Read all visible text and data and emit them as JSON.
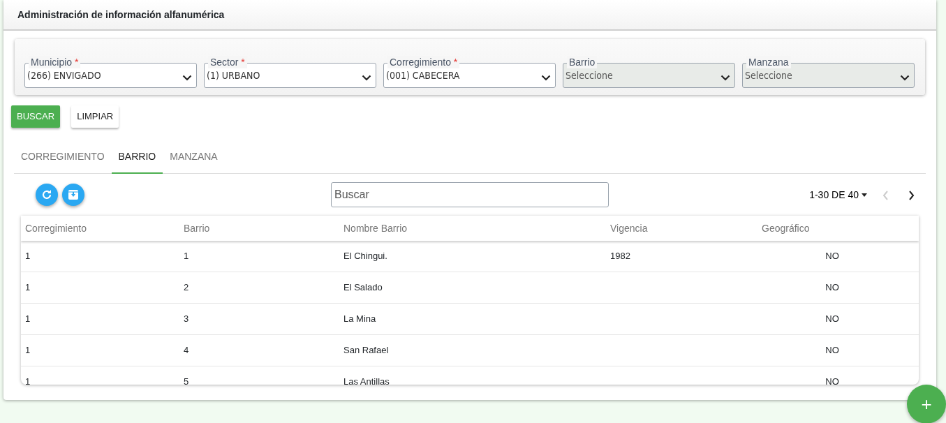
{
  "header": {
    "title": "Administración de información alfanumérica"
  },
  "filters": [
    {
      "label": "Municipio",
      "required_mark": "*",
      "value": "(266) ENVIGADO",
      "disabled": false
    },
    {
      "label": "Sector",
      "required_mark": "*",
      "value": "(1) URBANO",
      "disabled": false
    },
    {
      "label": "Corregimiento",
      "required_mark": "*",
      "value": "(001) CABECERA",
      "disabled": false
    },
    {
      "label": "Barrio",
      "value": "Seleccione",
      "disabled": true
    },
    {
      "label": "Manzana",
      "value": "Seleccione",
      "disabled": true
    }
  ],
  "actions": [
    {
      "label": "BUSCAR",
      "kind": "primary"
    },
    {
      "label": "LIMPIAR",
      "kind": "plain"
    }
  ],
  "tabs": [
    {
      "label": "CORREGIMIENTO",
      "selected": false
    },
    {
      "label": "BARRIO",
      "selected": true
    },
    {
      "label": "MANZANA",
      "selected": false
    }
  ],
  "search": {
    "placeholder": "Buscar"
  },
  "pagination": {
    "range": "1-30 DE 40",
    "prev_disabled": true,
    "next_disabled": false
  },
  "table": {
    "columns": [
      "Corregimiento",
      "Barrio",
      "Nombre Barrio",
      "Vigencia",
      "Geográfico"
    ],
    "rows": [
      [
        "1",
        "1",
        "El Chingui.",
        "1982",
        "NO"
      ],
      [
        "1",
        "2",
        "El Salado",
        "",
        "NO"
      ],
      [
        "1",
        "3",
        "La Mina",
        "",
        "NO"
      ],
      [
        "1",
        "4",
        "San Rafael",
        "",
        "NO"
      ],
      [
        "1",
        "5",
        "Las Antillas",
        "",
        "NO"
      ]
    ]
  },
  "fab": {
    "label": "+"
  }
}
